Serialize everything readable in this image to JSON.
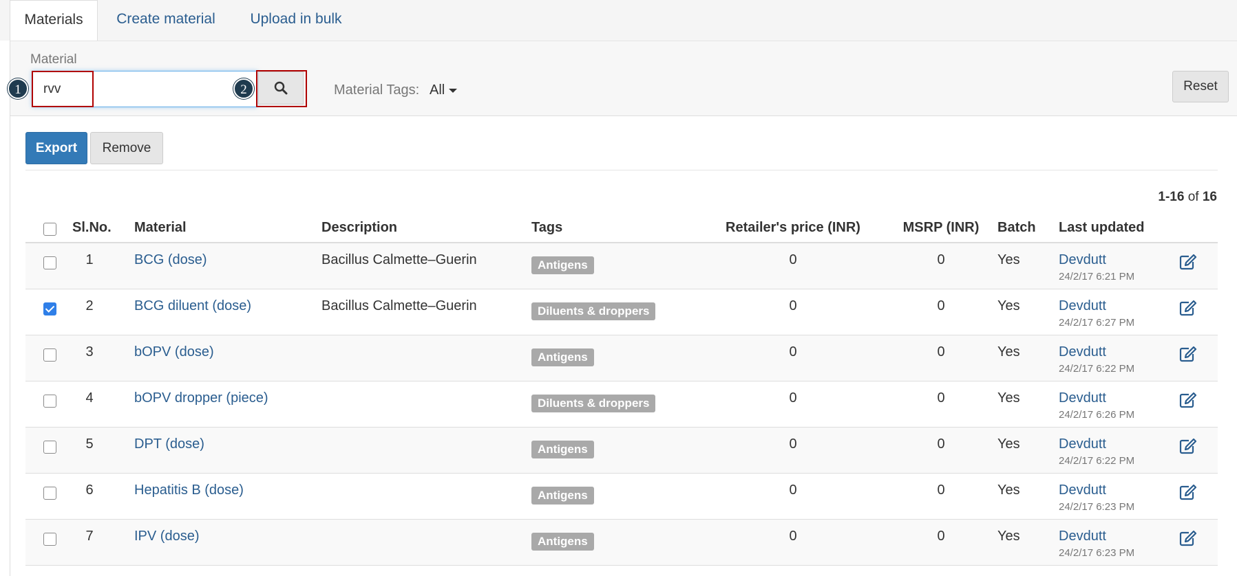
{
  "tabs": [
    {
      "label": "Materials"
    },
    {
      "label": "Create material"
    },
    {
      "label": "Upload in bulk"
    }
  ],
  "filter": {
    "material_label": "Material",
    "search_value": "rvv",
    "step1": "1",
    "step2": "2",
    "tags_label": "Material Tags:",
    "tags_value": "All",
    "reset_label": "Reset"
  },
  "toolbar": {
    "export_label": "Export",
    "remove_label": "Remove"
  },
  "pager": {
    "range": "1-16",
    "of": "of",
    "total": "16"
  },
  "table": {
    "headers": {
      "no": "Sl.No.",
      "material": "Material",
      "description": "Description",
      "tags": "Tags",
      "retailer_price": "Retailer's price (INR)",
      "msrp": "MSRP (INR)",
      "batch": "Batch",
      "last_updated": "Last updated"
    },
    "rows": [
      {
        "no": "1",
        "material": "BCG (dose)",
        "description": "Bacillus Calmette–Guerin",
        "tag": "Antigens",
        "retailer_price": "0",
        "msrp": "0",
        "batch": "Yes",
        "updated_by": "Devdutt",
        "updated_at": "24/2/17 6:21 PM",
        "checked": false
      },
      {
        "no": "2",
        "material": "BCG diluent (dose)",
        "description": "Bacillus Calmette–Guerin",
        "tag": "Diluents & droppers",
        "retailer_price": "0",
        "msrp": "0",
        "batch": "Yes",
        "updated_by": "Devdutt",
        "updated_at": "24/2/17 6:27 PM",
        "checked": true
      },
      {
        "no": "3",
        "material": "bOPV (dose)",
        "description": "",
        "tag": "Antigens",
        "retailer_price": "0",
        "msrp": "0",
        "batch": "Yes",
        "updated_by": "Devdutt",
        "updated_at": "24/2/17 6:22 PM",
        "checked": false
      },
      {
        "no": "4",
        "material": "bOPV dropper (piece)",
        "description": "",
        "tag": "Diluents & droppers",
        "retailer_price": "0",
        "msrp": "0",
        "batch": "Yes",
        "updated_by": "Devdutt",
        "updated_at": "24/2/17 6:26 PM",
        "checked": false
      },
      {
        "no": "5",
        "material": "DPT (dose)",
        "description": "",
        "tag": "Antigens",
        "retailer_price": "0",
        "msrp": "0",
        "batch": "Yes",
        "updated_by": "Devdutt",
        "updated_at": "24/2/17 6:22 PM",
        "checked": false
      },
      {
        "no": "6",
        "material": "Hepatitis B (dose)",
        "description": "",
        "tag": "Antigens",
        "retailer_price": "0",
        "msrp": "0",
        "batch": "Yes",
        "updated_by": "Devdutt",
        "updated_at": "24/2/17 6:23 PM",
        "checked": false
      },
      {
        "no": "7",
        "material": "IPV (dose)",
        "description": "",
        "tag": "Antigens",
        "retailer_price": "0",
        "msrp": "0",
        "batch": "Yes",
        "updated_by": "Devdutt",
        "updated_at": "24/2/17 6:23 PM",
        "checked": false
      }
    ]
  },
  "colors": {
    "link": "#2a5d8f",
    "primary": "#337ab7",
    "tag_bg": "#a9a9a9",
    "highlight_box": "#b00000",
    "step_badge": "#1f3b4f"
  },
  "icons": {
    "search": "search-icon",
    "edit": "edit-icon",
    "caret": "caret-down-icon"
  }
}
